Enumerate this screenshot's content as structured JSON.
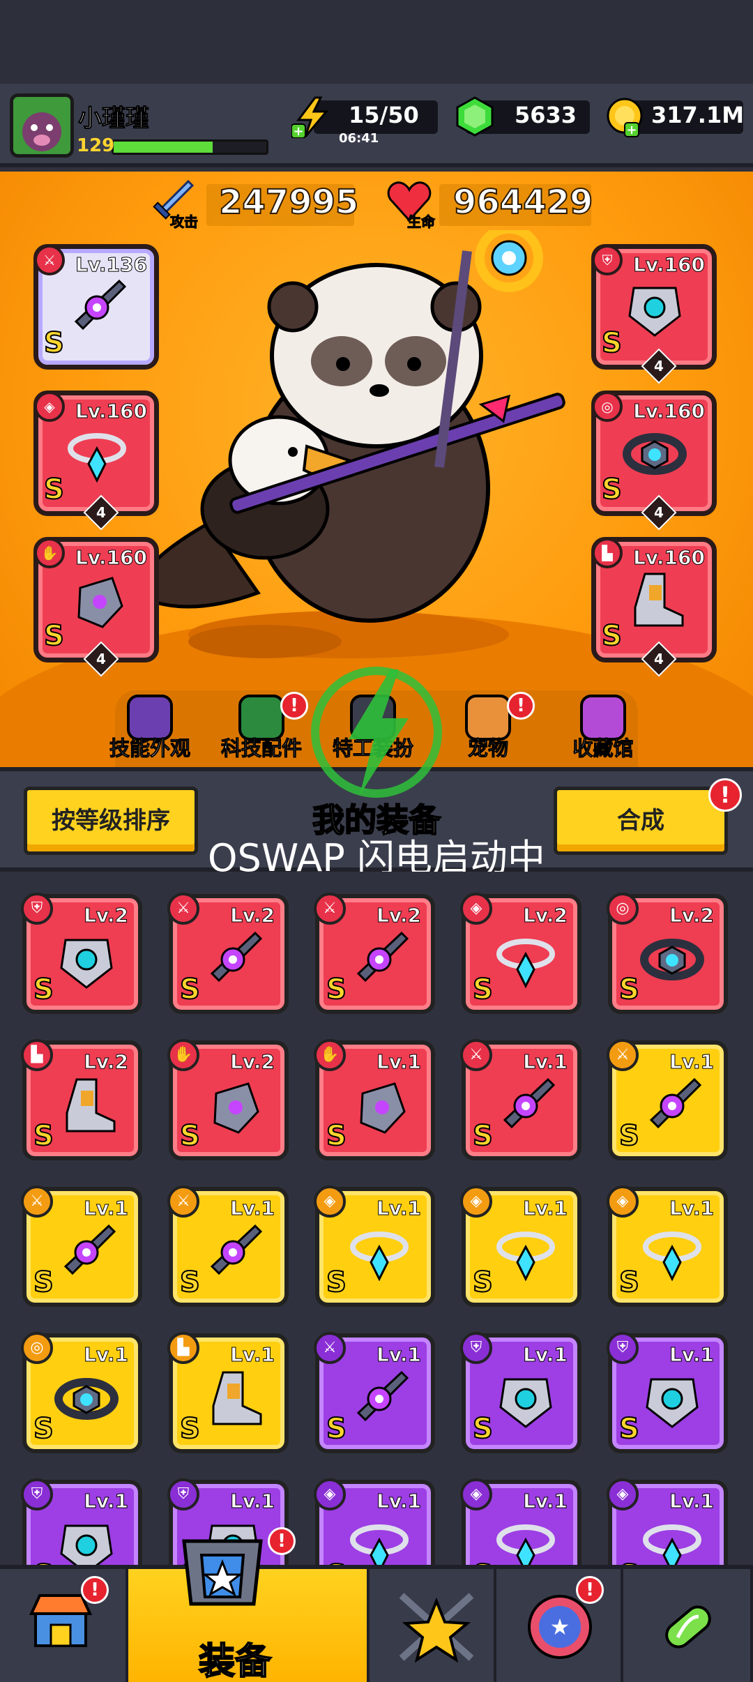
{
  "player": {
    "name": "小瑾瑾",
    "level": "129",
    "xp_fraction": 0.65
  },
  "resources": {
    "energy": "15/50",
    "energy_timer": "06:41",
    "gems": "5633",
    "coins": "317.1M"
  },
  "stats": {
    "attack": "247995",
    "attack_label": "攻击",
    "hp": "964429",
    "hp_label": "生命"
  },
  "equipped": [
    {
      "slot": "weapon",
      "level": "Lv.136",
      "rank": "S",
      "stars": "",
      "style": "white"
    },
    {
      "slot": "necklace",
      "level": "Lv.160",
      "rank": "S",
      "stars": "4",
      "style": "red"
    },
    {
      "slot": "gloves",
      "level": "Lv.160",
      "rank": "S",
      "stars": "4",
      "style": "red"
    },
    {
      "slot": "armor",
      "level": "Lv.160",
      "rank": "S",
      "stars": "4",
      "style": "red"
    },
    {
      "slot": "belt",
      "level": "Lv.160",
      "rank": "S",
      "stars": "4",
      "style": "red"
    },
    {
      "slot": "boots",
      "level": "Lv.160",
      "rank": "S",
      "stars": "4",
      "style": "red"
    }
  ],
  "tabs": [
    {
      "label": "技能外观",
      "badge": false
    },
    {
      "label": "科技配件",
      "badge": true
    },
    {
      "label": "特工装扮",
      "badge": false
    },
    {
      "label": "宠物",
      "badge": true
    },
    {
      "label": "收藏馆",
      "badge": false
    }
  ],
  "toolbar": {
    "sort_label": "按等级排序",
    "title": "我的装备",
    "merge_label": "合成",
    "merge_badge": "!"
  },
  "overlay": {
    "text": "OSWAP 闪电启动中"
  },
  "inventory": [
    {
      "level": "Lv.2",
      "rarity": "red",
      "slot": "armor",
      "rank": "S"
    },
    {
      "level": "Lv.2",
      "rarity": "red",
      "slot": "weapon",
      "rank": "S"
    },
    {
      "level": "Lv.2",
      "rarity": "red",
      "slot": "weapon",
      "rank": "S"
    },
    {
      "level": "Lv.2",
      "rarity": "red",
      "slot": "necklace",
      "rank": "S"
    },
    {
      "level": "Lv.2",
      "rarity": "red",
      "slot": "belt",
      "rank": "S"
    },
    {
      "level": "Lv.2",
      "rarity": "red",
      "slot": "boots",
      "rank": "S"
    },
    {
      "level": "Lv.2",
      "rarity": "red",
      "slot": "gloves",
      "rank": "S"
    },
    {
      "level": "Lv.1",
      "rarity": "red",
      "slot": "gloves",
      "rank": "S"
    },
    {
      "level": "Lv.1",
      "rarity": "red",
      "slot": "weapon",
      "rank": "S"
    },
    {
      "level": "Lv.1",
      "rarity": "yel",
      "slot": "weapon",
      "rank": "S"
    },
    {
      "level": "Lv.1",
      "rarity": "yel",
      "slot": "weapon",
      "rank": "S"
    },
    {
      "level": "Lv.1",
      "rarity": "yel",
      "slot": "weapon",
      "rank": "S"
    },
    {
      "level": "Lv.1",
      "rarity": "yel",
      "slot": "necklace",
      "rank": "S"
    },
    {
      "level": "Lv.1",
      "rarity": "yel",
      "slot": "necklace",
      "rank": "S"
    },
    {
      "level": "Lv.1",
      "rarity": "yel",
      "slot": "necklace",
      "rank": "S"
    },
    {
      "level": "Lv.1",
      "rarity": "yel",
      "slot": "belt",
      "rank": "S"
    },
    {
      "level": "Lv.1",
      "rarity": "yel",
      "slot": "boots",
      "rank": "S"
    },
    {
      "level": "Lv.1",
      "rarity": "pur",
      "slot": "weapon",
      "rank": "S"
    },
    {
      "level": "Lv.1",
      "rarity": "pur",
      "slot": "armor",
      "rank": "S"
    },
    {
      "level": "Lv.1",
      "rarity": "pur",
      "slot": "armor",
      "rank": "S"
    },
    {
      "level": "Lv.1",
      "rarity": "pur",
      "slot": "armor",
      "rank": "S"
    },
    {
      "level": "Lv.1",
      "rarity": "pur",
      "slot": "armor",
      "rank": "S"
    },
    {
      "level": "Lv.1",
      "rarity": "pur",
      "slot": "necklace",
      "rank": "S"
    },
    {
      "level": "Lv.1",
      "rarity": "pur",
      "slot": "necklace",
      "rank": "S"
    },
    {
      "level": "Lv.1",
      "rarity": "pur",
      "slot": "necklace",
      "rank": "S"
    }
  ],
  "bottom_nav": [
    {
      "label": "",
      "icon": "shop-icon",
      "badge": true,
      "active": false
    },
    {
      "label": "装备",
      "icon": "equipment-icon",
      "badge": true,
      "active": true
    },
    {
      "label": "",
      "icon": "star-swords-icon",
      "badge": false,
      "active": false
    },
    {
      "label": "",
      "icon": "planet-icon",
      "badge": true,
      "active": false
    },
    {
      "label": "",
      "icon": "dna-capsule-icon",
      "badge": false,
      "active": false
    }
  ],
  "colors": {
    "gold": "#ff9c0e",
    "red_rarity": "#ef3d52",
    "yellow_rarity": "#ffcf10",
    "purple_rarity": "#9d3fe4",
    "badge": "#e6232f",
    "xp": "#5ddc3a"
  }
}
